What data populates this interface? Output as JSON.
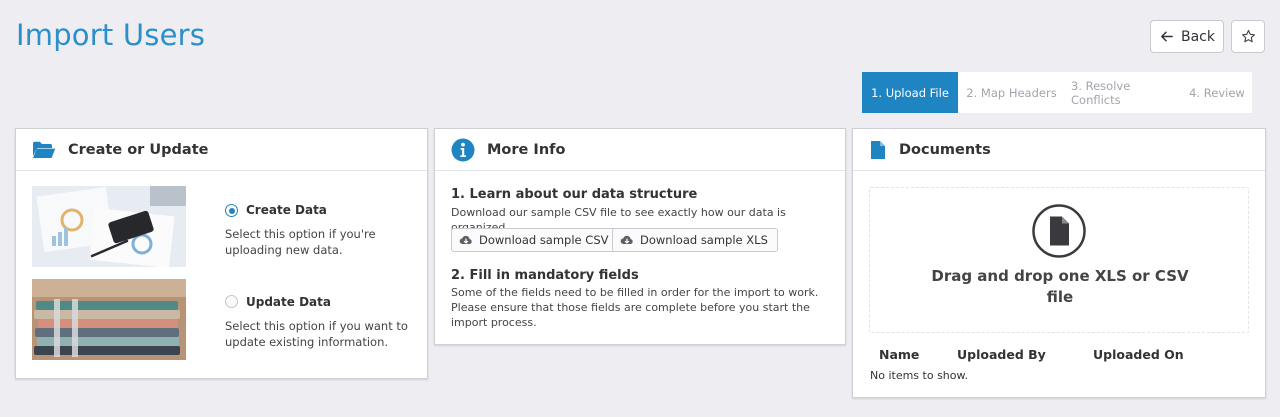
{
  "page": {
    "title": "Import Users"
  },
  "header": {
    "back_label": "Back"
  },
  "wizard": {
    "steps": [
      {
        "label": "1. Upload File",
        "active": true
      },
      {
        "label": "2. Map Headers",
        "active": false
      },
      {
        "label": "3. Resolve Conflicts",
        "active": false
      },
      {
        "label": "4. Review",
        "active": false
      }
    ]
  },
  "create_update": {
    "title": "Create or Update",
    "options": [
      {
        "label": "Create Data",
        "description": "Select this option if you're uploading new data.",
        "selected": true
      },
      {
        "label": "Update Data",
        "description": "Select this option if you want to update existing information.",
        "selected": false
      }
    ]
  },
  "more_info": {
    "title": "More Info",
    "section1": {
      "heading": "1. Learn about our data structure",
      "text": "Download our sample CSV file to see exactly how our data is organized.",
      "csv_button": "Download sample CSV",
      "xls_button": "Download sample XLS"
    },
    "section2": {
      "heading": "2. Fill in mandatory fields",
      "text": "Some of the fields need to be filled in order for the import to work. Please ensure that those fields are complete before you start the import process."
    }
  },
  "documents": {
    "title": "Documents",
    "dropzone_text": "Drag and drop one XLS or CSV file",
    "columns": [
      "Name",
      "Uploaded By",
      "Uploaded On"
    ],
    "empty_message": "No items to show."
  },
  "colors": {
    "accent": "#1e85c2",
    "title": "#2b90c9",
    "background": "#eeedf1"
  }
}
